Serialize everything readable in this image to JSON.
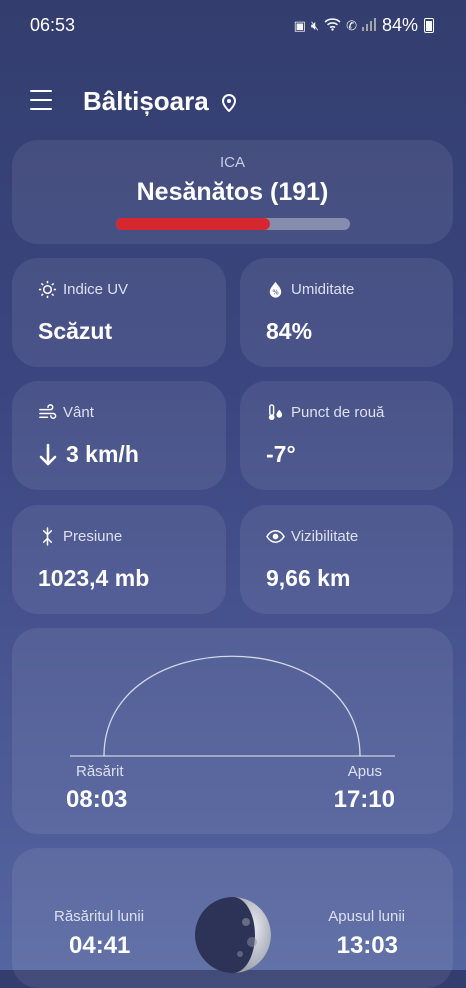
{
  "status_bar": {
    "time": "06:53",
    "battery": "84%"
  },
  "header": {
    "city": "Bâltișoara"
  },
  "aqi": {
    "label": "ICA",
    "value": "Nesănătos (191)",
    "level": 0.66,
    "color": "#d7262d"
  },
  "tiles": [
    {
      "label": "Indice UV",
      "value": "Scăzut",
      "icon": "sun-icon"
    },
    {
      "label": "Umiditate",
      "value": "84%",
      "icon": "humidity-icon"
    },
    {
      "label": "Vânt",
      "value": "3 km/h",
      "icon": "wind-icon",
      "extra_icon": "arrow-down-icon"
    },
    {
      "label": "Punct de rouă",
      "value": "-7°",
      "icon": "dew-point-icon"
    },
    {
      "label": "Presiune",
      "value": "1023,4 mb",
      "icon": "pressure-icon"
    },
    {
      "label": "Vizibilitate",
      "value": "9,66 km",
      "icon": "eye-icon"
    }
  ],
  "sun": {
    "rise_label": "Răsărit",
    "rise_time": "08:03",
    "set_label": "Apus",
    "set_time": "17:10"
  },
  "moon": {
    "rise_label": "Răsăritul lunii",
    "rise_time": "04:41",
    "set_label": "Apusul lunii",
    "set_time": "13:03"
  }
}
